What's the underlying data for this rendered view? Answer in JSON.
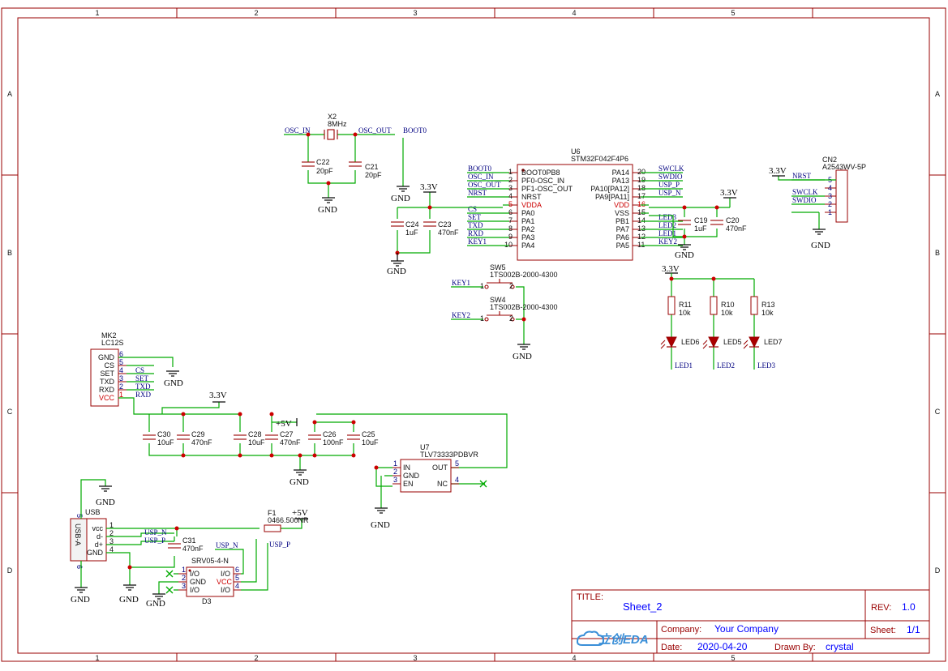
{
  "frame": {
    "col_labels": [
      "1",
      "2",
      "3",
      "4",
      "5"
    ],
    "row_labels": [
      "A",
      "B",
      "C",
      "D"
    ]
  },
  "title_block": {
    "title_label": "TITLE:",
    "title": "Sheet_2",
    "rev_label": "REV:",
    "rev": "1.0",
    "company_label": "Company:",
    "company": "Your Company",
    "sheet_label": "Sheet:",
    "sheet": "1/1",
    "date_label": "Date:",
    "date": "2020-04-20",
    "drawn_label": "Drawn By:",
    "drawn": "crystal",
    "logo_text": "立创EDA"
  },
  "power": {
    "gnd": "GND",
    "v33": "3.3V",
    "v5": "+5V"
  },
  "crystal": {
    "ref": "X2",
    "value": "8MHz",
    "net_in": "OSC_IN",
    "net_out": "OSC_OUT",
    "boot": "BOOT0",
    "c22_ref": "C22",
    "c22_val": "20pF",
    "c21_ref": "C21",
    "c21_val": "20pF"
  },
  "mcu": {
    "ref": "U6",
    "part": "STM32F042F4P6",
    "left_pins": [
      {
        "num": "1",
        "name": "BOOT0PB8",
        "net": "BOOT0"
      },
      {
        "num": "2",
        "name": "PF0-OSC_IN",
        "net": "OSC_IN"
      },
      {
        "num": "3",
        "name": "PF1-OSC_OUT",
        "net": "OSC_OUT"
      },
      {
        "num": "4",
        "name": "NRST",
        "net": "NRST"
      },
      {
        "num": "5",
        "name": "VDDA",
        "net": ""
      },
      {
        "num": "6",
        "name": "PA0",
        "net": "CS"
      },
      {
        "num": "7",
        "name": "PA1",
        "net": "SET"
      },
      {
        "num": "8",
        "name": "PA2",
        "net": "TXD"
      },
      {
        "num": "9",
        "name": "PA3",
        "net": "RXD"
      },
      {
        "num": "10",
        "name": "PA4",
        "net": "KEY1"
      }
    ],
    "right_pins": [
      {
        "num": "20",
        "name": "PA14",
        "net": "SWCLK"
      },
      {
        "num": "19",
        "name": "PA13",
        "net": "SWDIO"
      },
      {
        "num": "18",
        "name": "PA10[PA12]",
        "net": "USP_P"
      },
      {
        "num": "17",
        "name": "PA9[PA11]",
        "net": "USP_N"
      },
      {
        "num": "16",
        "name": "VDD",
        "net": ""
      },
      {
        "num": "15",
        "name": "VSS",
        "net": ""
      },
      {
        "num": "14",
        "name": "PB1",
        "net": "LED3"
      },
      {
        "num": "13",
        "name": "PA7",
        "net": "LED2"
      },
      {
        "num": "12",
        "name": "PA6",
        "net": "LED1"
      },
      {
        "num": "11",
        "name": "PA5",
        "net": "KEY2"
      }
    ],
    "c24_ref": "C24",
    "c24_val": "1uF",
    "c23_ref": "C23",
    "c23_val": "470nF",
    "c19_ref": "C19",
    "c19_val": "1uF",
    "c20_ref": "C20",
    "c20_val": "470nF"
  },
  "connector": {
    "ref": "CN2",
    "part": "A2543WV-5P",
    "pins": [
      {
        "num": "5",
        "net": "NRST"
      },
      {
        "num": "4",
        "net": ""
      },
      {
        "num": "3",
        "net": "SWCLK"
      },
      {
        "num": "2",
        "net": "SWDIO"
      },
      {
        "num": "1",
        "net": ""
      }
    ]
  },
  "switches": [
    {
      "ref": "SW5",
      "part": "1TS002B-2000-4300",
      "net": "KEY1",
      "p1": "1",
      "p2": "2"
    },
    {
      "ref": "SW4",
      "part": "1TS002B-2000-4300",
      "net": "KEY2",
      "p1": "1",
      "p2": "2"
    }
  ],
  "leds": [
    {
      "r_ref": "R11",
      "r_val": "10k",
      "led": "LED6",
      "net": "LED1"
    },
    {
      "r_ref": "R10",
      "r_val": "10k",
      "led": "LED5",
      "net": "LED2"
    },
    {
      "r_ref": "R13",
      "r_val": "10k",
      "led": "LED7",
      "net": "LED3"
    }
  ],
  "module": {
    "ref": "MK2",
    "part": "LC12S",
    "pins": [
      {
        "name": "GND",
        "num": "6",
        "net": "",
        "red": false
      },
      {
        "name": "CS",
        "num": "5",
        "net": "CS",
        "red": false
      },
      {
        "name": "SET",
        "num": "4",
        "net": "SET",
        "red": false
      },
      {
        "name": "TXD",
        "num": "3",
        "net": "TXD",
        "red": false
      },
      {
        "name": "RXD",
        "num": "2",
        "net": "RXD",
        "red": false
      },
      {
        "name": "VCC",
        "num": "1",
        "net": "",
        "red": true
      }
    ]
  },
  "ldo": {
    "ref": "U7",
    "part": "TLV73333PDBVR",
    "in": "IN",
    "gnd": "GND",
    "en": "EN",
    "out": "OUT",
    "nc": "NC",
    "p1": "1",
    "p2": "2",
    "p3": "3",
    "p5": "5",
    "p4": "4",
    "caps": [
      {
        "ref": "C30",
        "val": "10uF"
      },
      {
        "ref": "C29",
        "val": "470nF"
      },
      {
        "ref": "C28",
        "val": "10uF"
      },
      {
        "ref": "C27",
        "val": "470nF"
      },
      {
        "ref": "C26",
        "val": "100nF"
      },
      {
        "ref": "C25",
        "val": "10uF"
      }
    ]
  },
  "usb": {
    "ref": "USB",
    "part": "USB-A",
    "pins": [
      {
        "name": "vcc",
        "num": "1"
      },
      {
        "name": "d-",
        "num": "2"
      },
      {
        "name": "d+",
        "num": "3"
      },
      {
        "name": "GND",
        "num": "4"
      }
    ],
    "shield5": "5",
    "shield6": "6",
    "net_n": "USP_N",
    "net_p": "USP_P",
    "c31_ref": "C31",
    "c31_val": "470nF",
    "fuse_ref": "F1",
    "fuse_val": "0466.500NR"
  },
  "tvs": {
    "ref": "D3",
    "part": "SRV05-4-N",
    "l1": "I/O",
    "l2": "GND",
    "l3": "I/O",
    "r1": "I/O",
    "r2": "VCC",
    "r3": "I/O",
    "n1": "1",
    "n2": "2",
    "n3": "3",
    "n4": "4",
    "n5": "5",
    "n6": "6",
    "net_n": "USP_N",
    "net_p": "USP_P"
  }
}
